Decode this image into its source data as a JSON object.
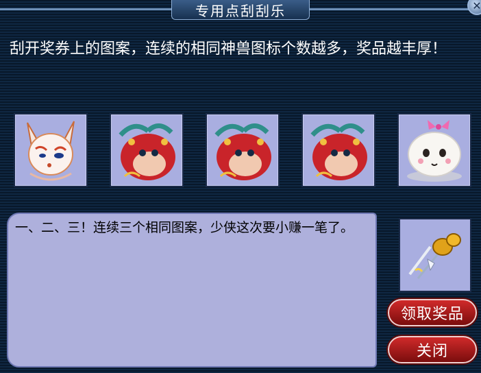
{
  "window": {
    "title": "专用点刮刮乐"
  },
  "intro_text": "刮开奖券上的图案，连续的相同神兽图标个数越多，奖品越丰厚！",
  "slots": [
    {
      "icon": "fox-spirit-icon"
    },
    {
      "icon": "red-dragon-icon"
    },
    {
      "icon": "red-dragon-icon"
    },
    {
      "icon": "red-dragon-icon"
    },
    {
      "icon": "bun-spirit-icon"
    }
  ],
  "message": "一、二、三！连续三个相同图案，少侠这次要小赚一笔了。",
  "prize": {
    "icon": "golden-gourd-icon"
  },
  "buttons": {
    "claim_label": "领取奖品",
    "close_label": "关闭"
  },
  "colors": {
    "background": "#0b1e33",
    "slot_bg": "#a9aee0",
    "message_bg": "#aeb0dc",
    "button_red": "#b01c1c"
  }
}
